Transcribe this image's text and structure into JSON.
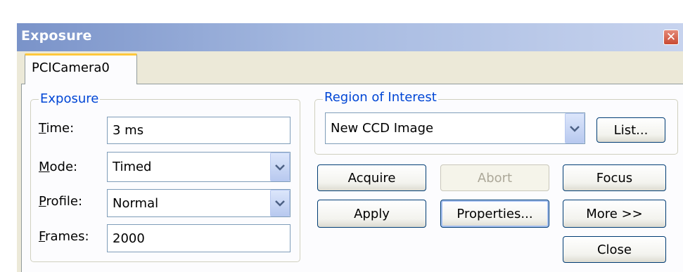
{
  "window": {
    "title": "Exposure",
    "close_glyph": "✕"
  },
  "tabs": [
    {
      "label": "PCICamera0",
      "active": true
    }
  ],
  "exposure_group": {
    "legend": "Exposure",
    "time": {
      "label_first": "T",
      "label_rest": "ime:",
      "value": "3 ms"
    },
    "mode": {
      "label_first": "M",
      "label_rest": "ode:",
      "value": "Timed"
    },
    "profile": {
      "label_first": "P",
      "label_rest": "rofile:",
      "value": "Normal"
    },
    "frames": {
      "label_first": "F",
      "label_rest": "rames:",
      "value": "2000"
    }
  },
  "roi_group": {
    "legend": "Region of Interest",
    "selected": "New CCD Image",
    "list_button": "List..."
  },
  "buttons": {
    "acquire": "Acquire",
    "abort": "Abort",
    "focus": "Focus",
    "apply": "Apply",
    "properties": "Properties...",
    "more": "More >>",
    "close": "Close"
  },
  "colors": {
    "legend_text": "#0046d5",
    "tab_highlight": "#ffc83c",
    "disabled_text": "#aca899"
  }
}
